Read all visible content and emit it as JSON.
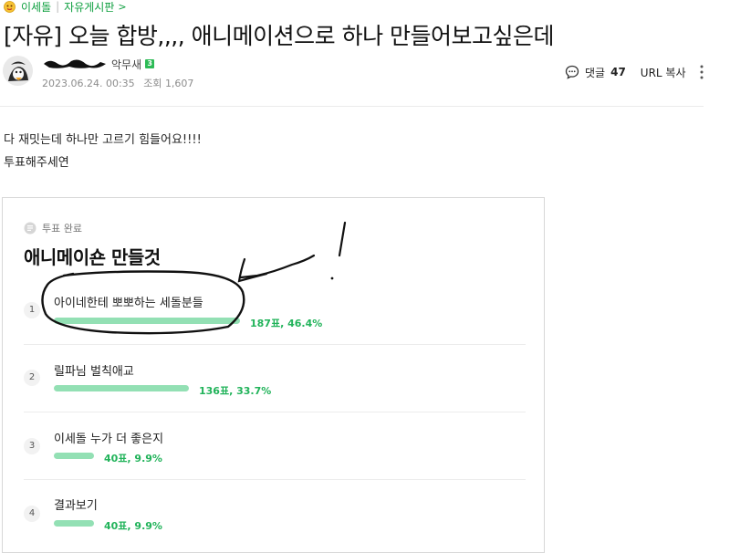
{
  "breadcrumb": {
    "cafe_name": "이세돌",
    "separator": "|",
    "board_name": "자유게시판",
    "arrow": ">"
  },
  "post": {
    "title": "[자유] 오늘 합방,,,, 애니메이션으로 하나 만들어보고싶은데",
    "author_suffix": "악무새",
    "level_badge": "3",
    "date": "2023.06.24. 00:35",
    "views_label": "조회",
    "views": "1,607",
    "comments_label": "댓글",
    "comments_count": "47",
    "url_copy_label": "URL 복사",
    "body": [
      "다 재밋는데 하나만 고르기 힘들어요!!!!",
      "투표해주세연"
    ]
  },
  "vote": {
    "status": "투표 완료",
    "title": "애니메이숀 만들것",
    "options": [
      {
        "number": "1",
        "label": "아이네한테 뽀뽀하는 세돌분들",
        "stat": "187표, 46.4%",
        "percent": 46.4
      },
      {
        "number": "2",
        "label": "릴파님 벌칙애교",
        "stat": "136표, 33.7%",
        "percent": 33.7
      },
      {
        "number": "3",
        "label": "이세돌 누가 더 좋은지",
        "stat": "40표, 9.9%",
        "percent": 9.9
      },
      {
        "number": "4",
        "label": "결과보기",
        "stat": "40표, 9.9%",
        "percent": 9.9
      }
    ]
  },
  "colors": {
    "accent_green": "#21b35a",
    "bar_green": "#93e0b4",
    "breadcrumb_green": "#0e9f3f"
  },
  "icons": {
    "cafe": "cafe-emoji-icon",
    "comment": "speech-bubble-icon",
    "more": "vertical-dots-icon",
    "vote_status": "list-document-icon"
  }
}
